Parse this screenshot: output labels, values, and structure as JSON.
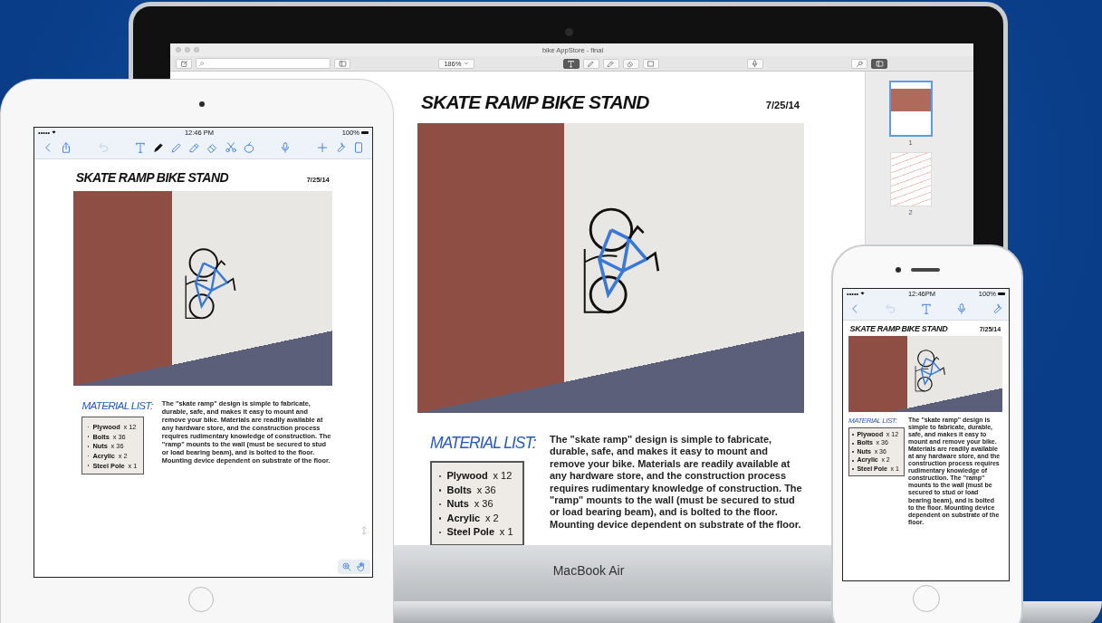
{
  "laptop": {
    "window": {
      "title": "bike AppStore - final"
    },
    "toolbar": [
      [
        {
          "kind": "compose",
          "selected": false
        },
        {
          "kind": "search_field",
          "selected": false
        },
        {
          "kind": "sidebar",
          "selected": false
        }
      ],
      [
        {
          "kind": "zoom",
          "label": "186%",
          "selected": false
        }
      ],
      [
        {
          "kind": "text",
          "selected": true
        },
        {
          "kind": "pen",
          "selected": false
        },
        {
          "kind": "highlighter",
          "selected": false
        },
        {
          "kind": "eraser",
          "selected": false
        },
        {
          "kind": "select",
          "selected": false
        }
      ],
      [
        {
          "kind": "mic",
          "selected": false
        }
      ],
      [
        {
          "kind": "search",
          "selected": false
        },
        {
          "kind": "sidebar",
          "selected": true
        }
      ]
    ],
    "document": {
      "title": "SKATE RAMP BIKE STAND",
      "date": "7/25/14",
      "material_heading": "MATERIAL LIST:",
      "materials": [
        "**Plywood** x 12",
        "**Bolts** x 36",
        "**Nuts** x 36",
        "**Acrylic** x 2",
        "**Steel Pole** x 1"
      ],
      "description": "The \"skate ramp\" design is simple to fabricate, durable, safe, and makes it easy to mount and remove your bike. Materials are readily available at any hardware store, and the construction process requires rudimentary knowledge of construction. The \"ramp\" mounts to the wall (must be secured to stud or load bearing beam), and is bolted to the floor. Mounting device dependent on substrate of the floor."
    },
    "thumbnails": [
      {
        "label": "1",
        "selected": true
      },
      {
        "label": "2",
        "selected": false
      }
    ],
    "brand": "MacBook Air"
  },
  "tablet": {
    "status_bar": {
      "carrier": "•••••",
      "time": "12:46 PM",
      "battery": "100%"
    },
    "toolbar": [
      [
        {
          "kind": "back",
          "selected": false
        },
        {
          "kind": "share",
          "selected": false
        }
      ],
      [
        {
          "kind": "undo",
          "selected": false
        }
      ],
      [
        {
          "kind": "text",
          "selected": false
        },
        {
          "kind": "marker",
          "selected": true
        },
        {
          "kind": "pen",
          "selected": false
        },
        {
          "kind": "highlighter",
          "selected": false
        },
        {
          "kind": "eraser",
          "selected": false
        },
        {
          "kind": "scissors",
          "selected": false
        },
        {
          "kind": "loop",
          "selected": false
        }
      ],
      [
        {
          "kind": "mic",
          "selected": false
        }
      ],
      [
        {
          "kind": "plus",
          "selected": false
        },
        {
          "kind": "wrench",
          "selected": false
        },
        {
          "kind": "page",
          "selected": false
        }
      ]
    ],
    "document": {
      "title": "SKATE RAMP BIKE STAND",
      "date": "7/25/14",
      "material_heading": "MATERIAL LIST:",
      "materials": [
        "**Plywood** x 12",
        "**Bolts** x 36",
        "**Nuts** x 36",
        "**Acrylic** x 2",
        "**Steel Pole** x 1"
      ],
      "description": "The \"skate ramp\" design is simple to fabricate, durable, safe, and makes it easy to mount and remove your bike. Materials are readily available at any hardware store, and the construction process requires rudimentary knowledge of construction. The \"ramp\" mounts to the wall (must be secured to stud or load bearing beam), and is bolted to the floor. Mounting device dependent on substrate of the floor."
    }
  },
  "phone": {
    "status_bar": {
      "carrier": "•••••",
      "time": "12:46PM",
      "battery": "100%"
    },
    "toolbar": [
      [
        {
          "kind": "back",
          "selected": false
        }
      ],
      [
        {
          "kind": "undo",
          "selected": false
        }
      ],
      [
        {
          "kind": "text",
          "selected": false
        }
      ],
      [
        {
          "kind": "mic",
          "selected": false
        }
      ],
      [
        {
          "kind": "wrench",
          "selected": false
        }
      ]
    ],
    "document": {
      "title": "SKATE RAMP BIKE STAND",
      "date": "7/25/14",
      "material_heading": "MATERIAL LIST:",
      "materials": [
        "**Plywood** x 12",
        "**Bolts** x 36",
        "**Nuts** x 36",
        "**Acrylic** x 2",
        "**Steel Pole** x 1"
      ],
      "description": "The \"skate ramp\" design is simple to fabricate, durable, safe, and makes it easy to mount and remove your bike. Materials are readily available at any hardware store, and the construction process requires rudimentary knowledge of construction. The \"ramp\" mounts to the wall (must be secured to stud or load bearing beam), and is bolted to the floor. Mounting device dependent on substrate of the floor."
    }
  }
}
